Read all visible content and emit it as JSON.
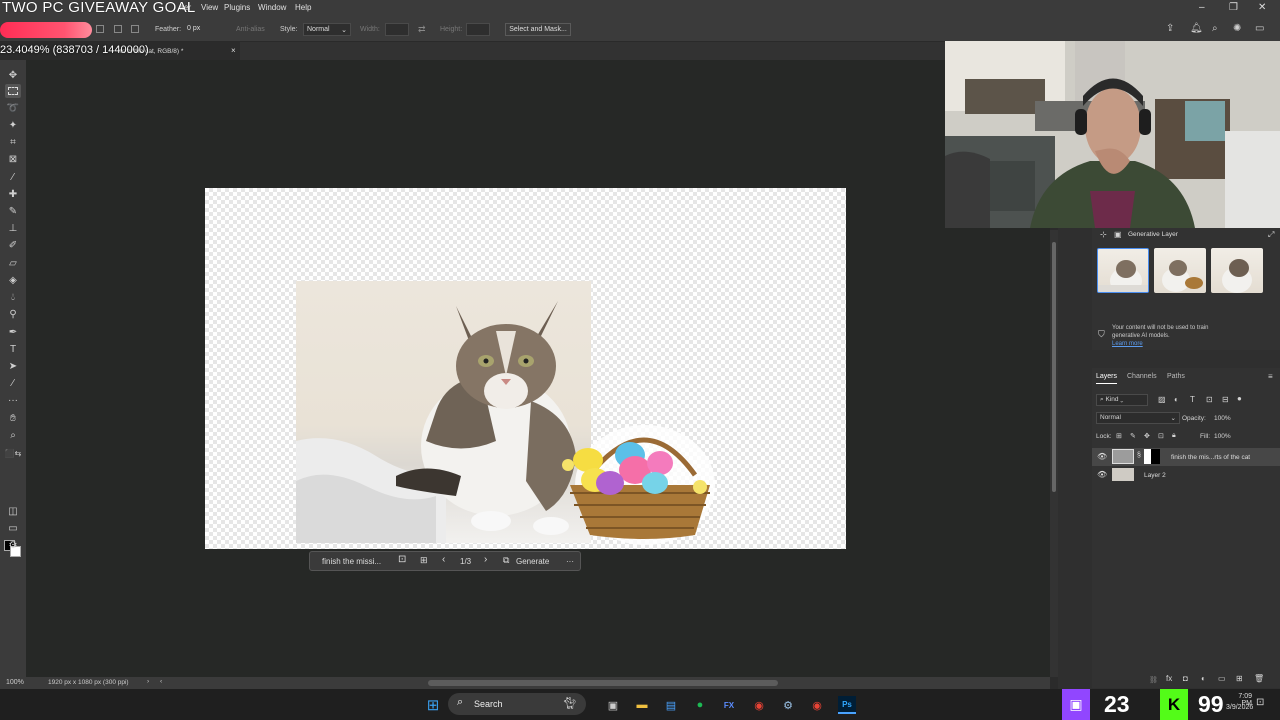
{
  "overlay": {
    "title": "TWO PC GIVEAWAY GOAL",
    "zoom_readout": "23.4049% (838703 / 1440000)"
  },
  "menu": {
    "items": [
      "lter",
      "View",
      "Plugins",
      "Window",
      "Help"
    ]
  },
  "options_bar": {
    "feather_label": "Feather:",
    "feather_value": "0 px",
    "anti_alias_label": "Anti-alias",
    "style_label": "Style:",
    "style_value": "Normal",
    "width_label": "Width:",
    "height_label": "Height:",
    "select_mask_label": "Select and Mask..."
  },
  "document_tab": {
    "title": "rts of the cat, RGB/8) *",
    "close": "×"
  },
  "context_bar": {
    "prompt_text": "finish the missi...",
    "counter": "1/3",
    "generate_label": "Generate",
    "more": "···"
  },
  "status_bar": {
    "zoom": "100%",
    "doc_info": "1920 px x 1080 px (300 ppi)"
  },
  "generative_panel": {
    "title": "Generative Layer",
    "notice": "Your content will not be used to train generative AI models.",
    "learn_more": "Learn more"
  },
  "layers_panel": {
    "tabs": [
      "Layers",
      "Channels",
      "Paths"
    ],
    "kind_label": "Kind",
    "blend_mode": "Normal",
    "opacity_label": "Opacity:",
    "opacity_value": "100%",
    "lock_label": "Lock:",
    "fill_label": "Fill:",
    "fill_value": "100%",
    "layers": [
      {
        "name": "finish the mis...rts of the cat",
        "selected": true
      },
      {
        "name": "Layer 2",
        "selected": false
      }
    ]
  },
  "taskbar": {
    "search_label": "Search",
    "clock_time": "7:09 PM",
    "clock_date": "3/9/2026",
    "overlay_left_count": "23",
    "overlay_right_count": "99",
    "colors": {
      "twitch": "#9146ff",
      "kick": "#53fc18"
    }
  }
}
